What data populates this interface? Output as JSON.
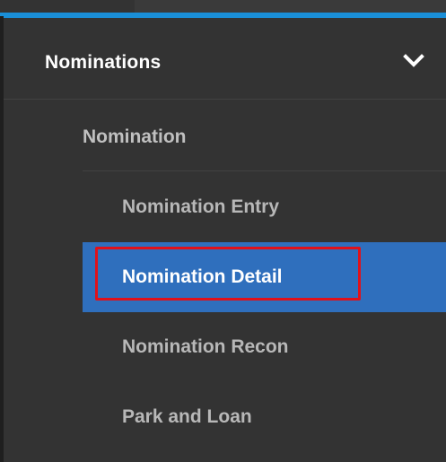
{
  "nav": {
    "section": {
      "label": "Nominations",
      "expanded_icon": "chevron-down-icon"
    },
    "group": {
      "label": "Nomination"
    },
    "items": [
      {
        "label": "Nomination Entry",
        "active": false
      },
      {
        "label": "Nomination Detail",
        "active": true,
        "highlighted": true
      },
      {
        "label": "Nomination Recon",
        "active": false
      },
      {
        "label": "Park and Loan",
        "active": false
      }
    ]
  },
  "colors": {
    "accent": "#1a8fd8",
    "active_background": "#2f6fbd",
    "highlight_border": "#e0111a",
    "menu_background": "#333333"
  }
}
